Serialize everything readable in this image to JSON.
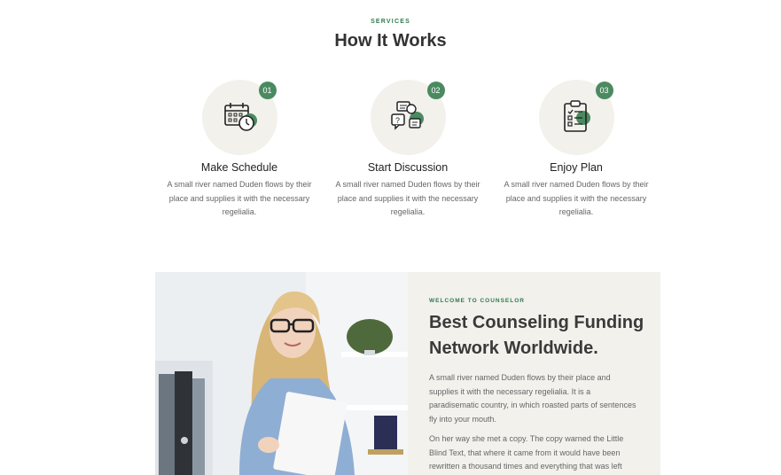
{
  "section": {
    "eyebrow": "SERVICES",
    "title": "How It Works"
  },
  "steps": [
    {
      "number": "01",
      "title": "Make Schedule",
      "description": "A small river named Duden flows by their place and supplies it with the necessary regelialia.",
      "icon": "calendar-icon"
    },
    {
      "number": "02",
      "title": "Start Discussion",
      "description": "A small river named Duden flows by their place and supplies it with the necessary regelialia.",
      "icon": "chat-bubbles-icon"
    },
    {
      "number": "03",
      "title": "Enjoy Plan",
      "description": "A small river named Duden flows by their place and supplies it with the necessary regelialia.",
      "icon": "clipboard-checklist-icon"
    }
  ],
  "about": {
    "kicker": "WELCOME TO COUNSELOR",
    "heading": "Best Counseling Funding Network Worldwide.",
    "paragraph1": "A small river named Duden flows by their place and supplies it with the necessary regelialia. It is a paradisematic country, in which roasted parts of sentences fly into your mouth.",
    "paragraph2": "On her way she met a copy. The copy warned the Little Blind Text, that where it came from it would have been rewritten a thousand times and everything that was left",
    "image": "counselor-woman-photo"
  },
  "colors": {
    "accent": "#4b8a60",
    "eyebrow": "#2f7a4e",
    "circle_bg": "#f2f1ec",
    "panel_bg": "#f2f1ec"
  }
}
